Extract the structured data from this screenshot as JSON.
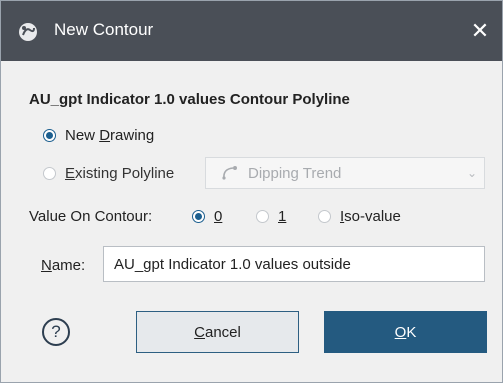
{
  "window": {
    "title": "New Contour",
    "close_glyph": "✕"
  },
  "heading": "AU_gpt Indicator 1.0 values Contour Polyline",
  "source_options": [
    {
      "label": "New Drawing",
      "mnemonic_before": "New ",
      "mnemonic": "D",
      "mnemonic_after": "rawing",
      "checked": true
    },
    {
      "label": "Existing Polyline",
      "mnemonic_before": "",
      "mnemonic": "E",
      "mnemonic_after": "xisting Polyline",
      "checked": false
    }
  ],
  "polyline_combo": {
    "value": "Dipping Trend",
    "icon": "polyline-curve-icon",
    "enabled": false
  },
  "value_on_contour": {
    "label": "Value On Contour:",
    "options": [
      {
        "label": "0",
        "mnemonic": "0",
        "checked": true
      },
      {
        "label": "1",
        "mnemonic": "1",
        "checked": false
      },
      {
        "label": "Iso-value",
        "mnemonic": "I",
        "rest": "so-value",
        "checked": false
      }
    ]
  },
  "name_field": {
    "label": "Name:",
    "mnemonic": "N",
    "rest": "ame:",
    "value": "AU_gpt Indicator 1.0 values outside"
  },
  "buttons": {
    "help": "?",
    "cancel_mnemonic": "C",
    "cancel_rest": "ancel",
    "ok_mnemonic": "O",
    "ok_rest": "K"
  },
  "colors": {
    "titlebar": "#4a4f57",
    "accent": "#245a80",
    "body": "#f0f0f0"
  }
}
